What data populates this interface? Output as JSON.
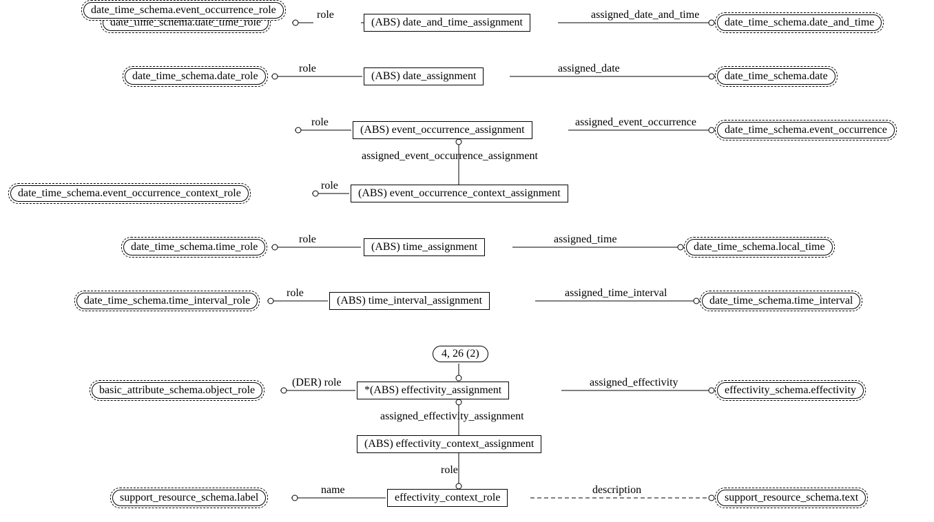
{
  "row1": {
    "left": "date_time_schema.date_time_role",
    "center": "(ABS) date_and_time_assignment",
    "right": "date_time_schema.date_and_time",
    "rel_left": "role",
    "rel_right": "assigned_date_and_time"
  },
  "row2": {
    "left": "date_time_schema.date_role",
    "center": "(ABS) date_assignment",
    "right": "date_time_schema.date",
    "rel_left": "role",
    "rel_right": "assigned_date"
  },
  "row3": {
    "left": "date_time_schema.event_occurrence_role",
    "center": "(ABS) event_occurrence_assignment",
    "right": "date_time_schema.event_occurrence",
    "rel_left": "role",
    "rel_right": "assigned_event_occurrence"
  },
  "row4": {
    "left": "date_time_schema.event_occurrence_context_role",
    "center": "(ABS) event_occurrence_context_assignment",
    "rel_left": "role",
    "rel_vert": "assigned_event_occurrence_assignment"
  },
  "row5": {
    "left": "date_time_schema.time_role",
    "center": "(ABS) time_assignment",
    "right": "date_time_schema.local_time",
    "rel_left": "role",
    "rel_right": "assigned_time"
  },
  "row6": {
    "left": "date_time_schema.time_interval_role",
    "center": "(ABS) time_interval_assignment",
    "right": "date_time_schema.time_interval",
    "rel_left": "role",
    "rel_right": "assigned_time_interval"
  },
  "row7": {
    "pageref": "4, 26 (2)",
    "left": "basic_attribute_schema.object_role",
    "center": "*(ABS) effectivity_assignment",
    "right": "effectivity_schema.effectivity",
    "rel_left": "(DER) role",
    "rel_right": "assigned_effectivity"
  },
  "row8": {
    "center": "(ABS) effectivity_context_assignment",
    "rel_vert": "assigned_effectivity_assignment"
  },
  "row9": {
    "left": "support_resource_schema.label",
    "center": "effectivity_context_role",
    "right": "support_resource_schema.text",
    "rel_left": "name",
    "rel_right": "description",
    "rel_vert": "role"
  }
}
